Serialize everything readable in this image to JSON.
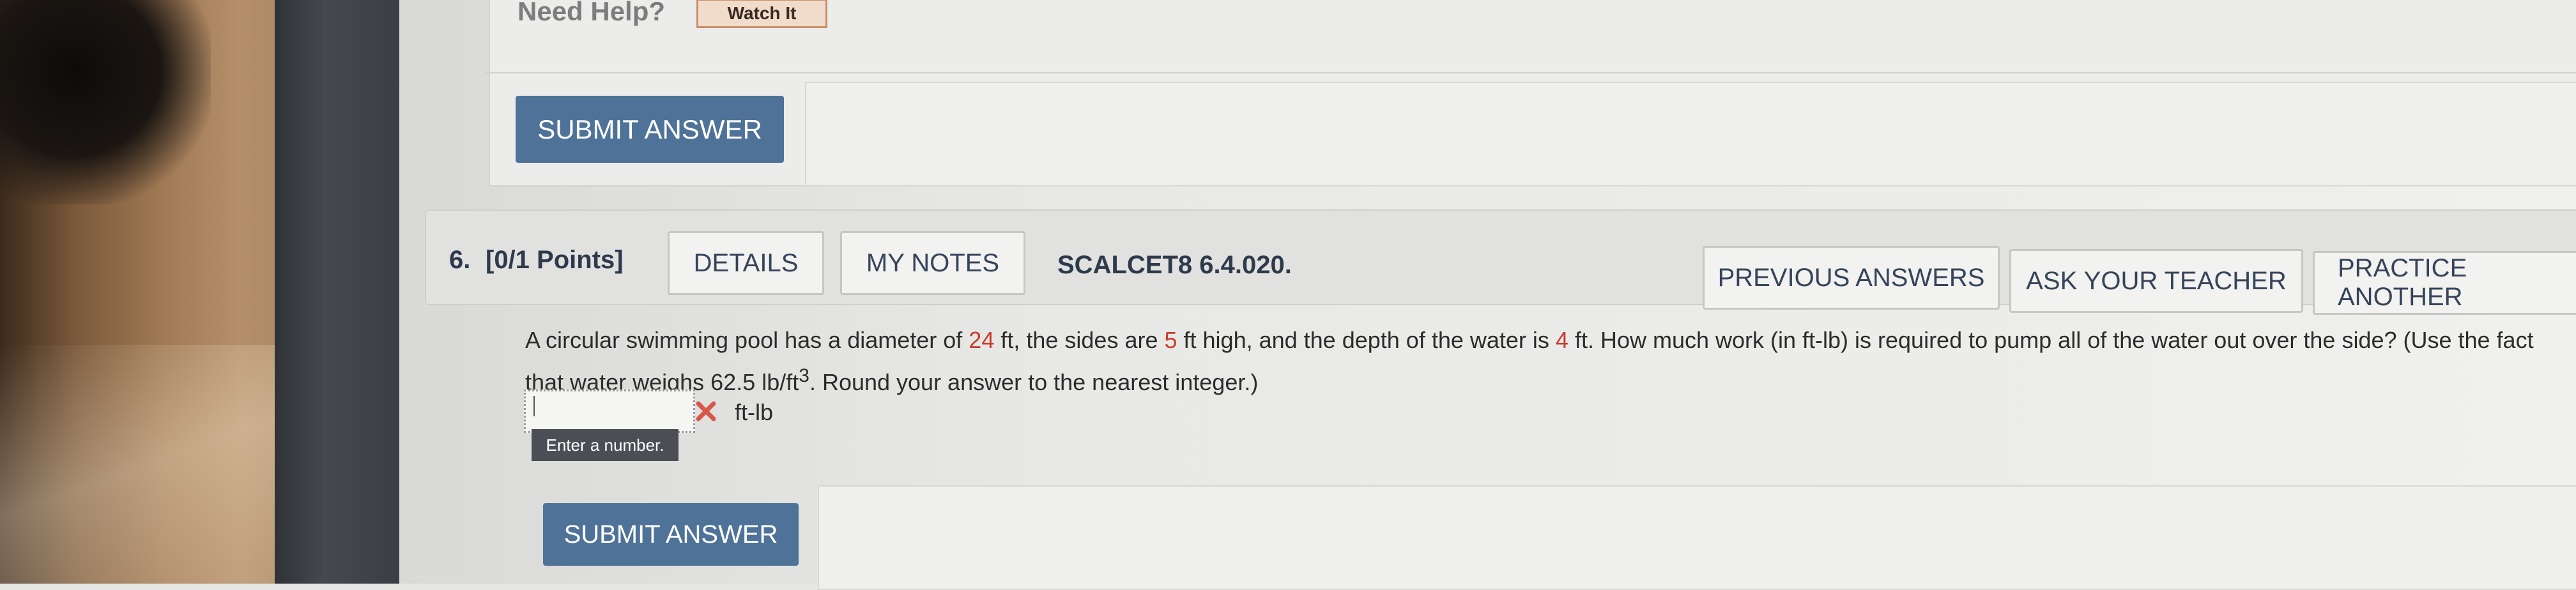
{
  "help": {
    "need_help": "Need Help?",
    "watch_it": "Watch It"
  },
  "submit_label": "SUBMIT ANSWER",
  "question": {
    "number": "6.",
    "points": "[0/1 Points]",
    "details": "DETAILS",
    "my_notes": "MY NOTES",
    "code": "SCALCET8 6.4.020.",
    "previous_answers": "PREVIOUS ANSWERS",
    "ask_teacher": "ASK YOUR TEACHER",
    "practice_another": "PRACTICE ANOTHER",
    "text": {
      "p1": "A circular swimming pool has a diameter of ",
      "diameter": "24",
      "p2": " ft, the sides are ",
      "sides": "5",
      "p3": " ft high, and the depth of the water is ",
      "depth": "4",
      "p4": " ft. How much work (in ft-lb) is required to pump all of the water out over the side? (Use the fact that water weighs 62.5 lb/ft",
      "sup": "3",
      "p5": ". Round your answer to the nearest integer.)"
    },
    "answer_value": "",
    "unit": "ft-lb",
    "tooltip": "Enter a number."
  },
  "colors": {
    "button_blue": "#4f7298",
    "highlight_red": "#cc3b2b"
  }
}
